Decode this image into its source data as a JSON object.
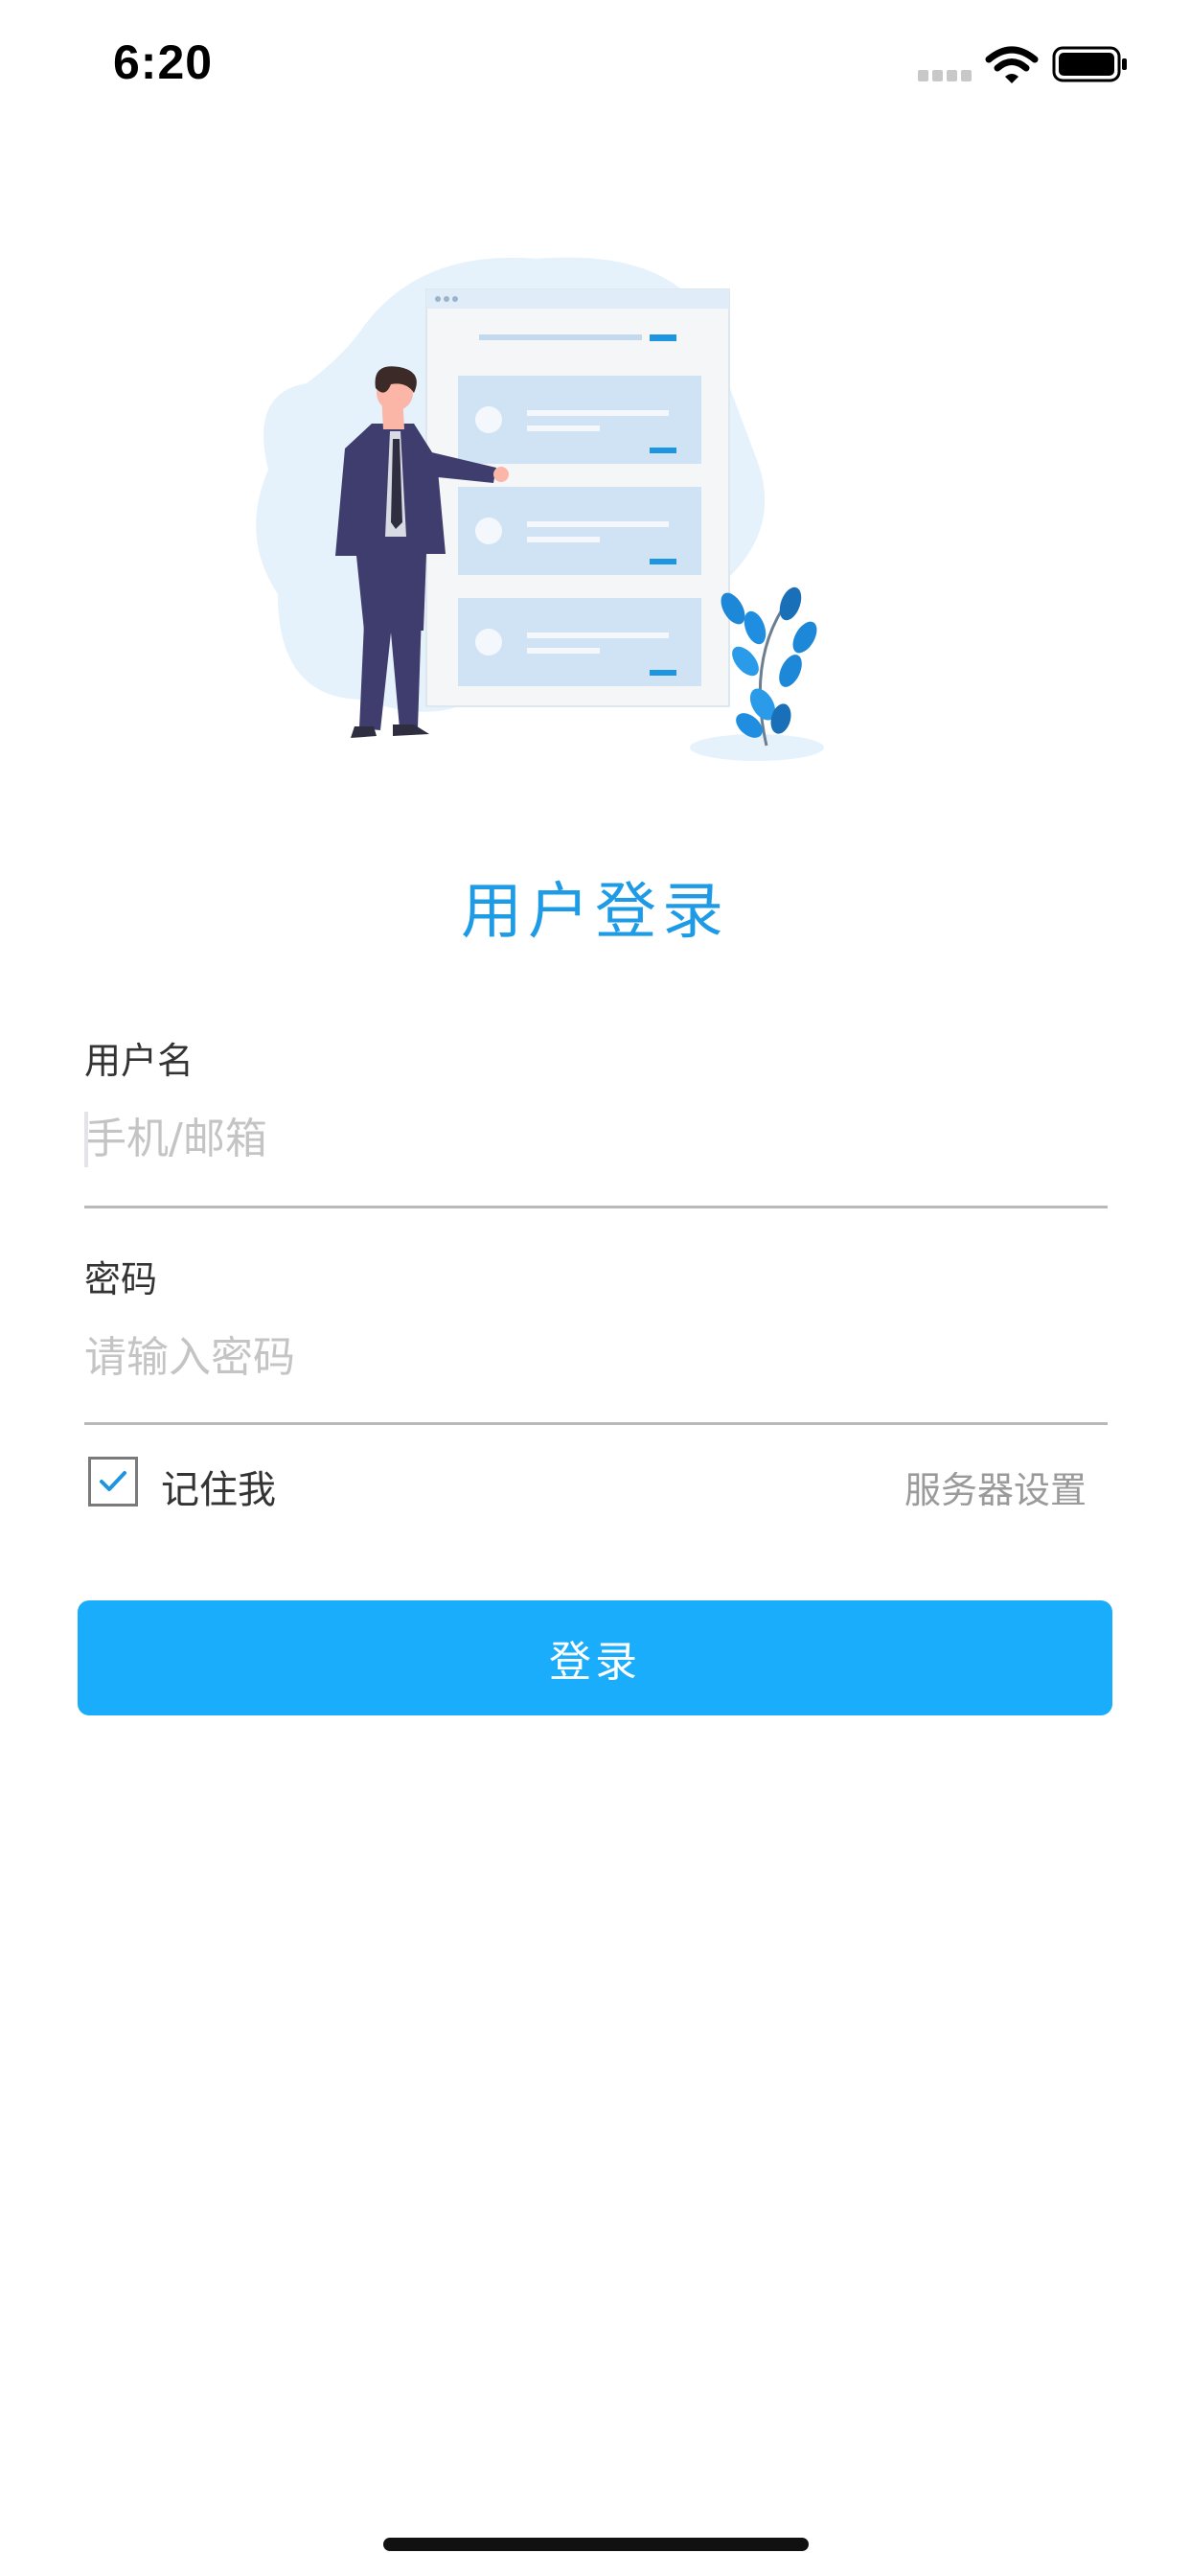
{
  "status_bar": {
    "time": "6:20"
  },
  "title": "用户登录",
  "username": {
    "label": "用户名",
    "placeholder": "手机/邮箱",
    "value": ""
  },
  "password": {
    "label": "密码",
    "placeholder": "请输入密码",
    "value": ""
  },
  "remember": {
    "label": "记住我",
    "checked": true
  },
  "server_settings_label": "服务器设置",
  "login_button_label": "登录",
  "colors": {
    "accent": "#1aadfb",
    "title": "#1e9be6",
    "illustration_light": "#e5f2fc",
    "suit": "#3f3d6e"
  },
  "icons": [
    "signal-icon",
    "wifi-icon",
    "battery-icon",
    "checkmark-icon",
    "login-illustration"
  ]
}
